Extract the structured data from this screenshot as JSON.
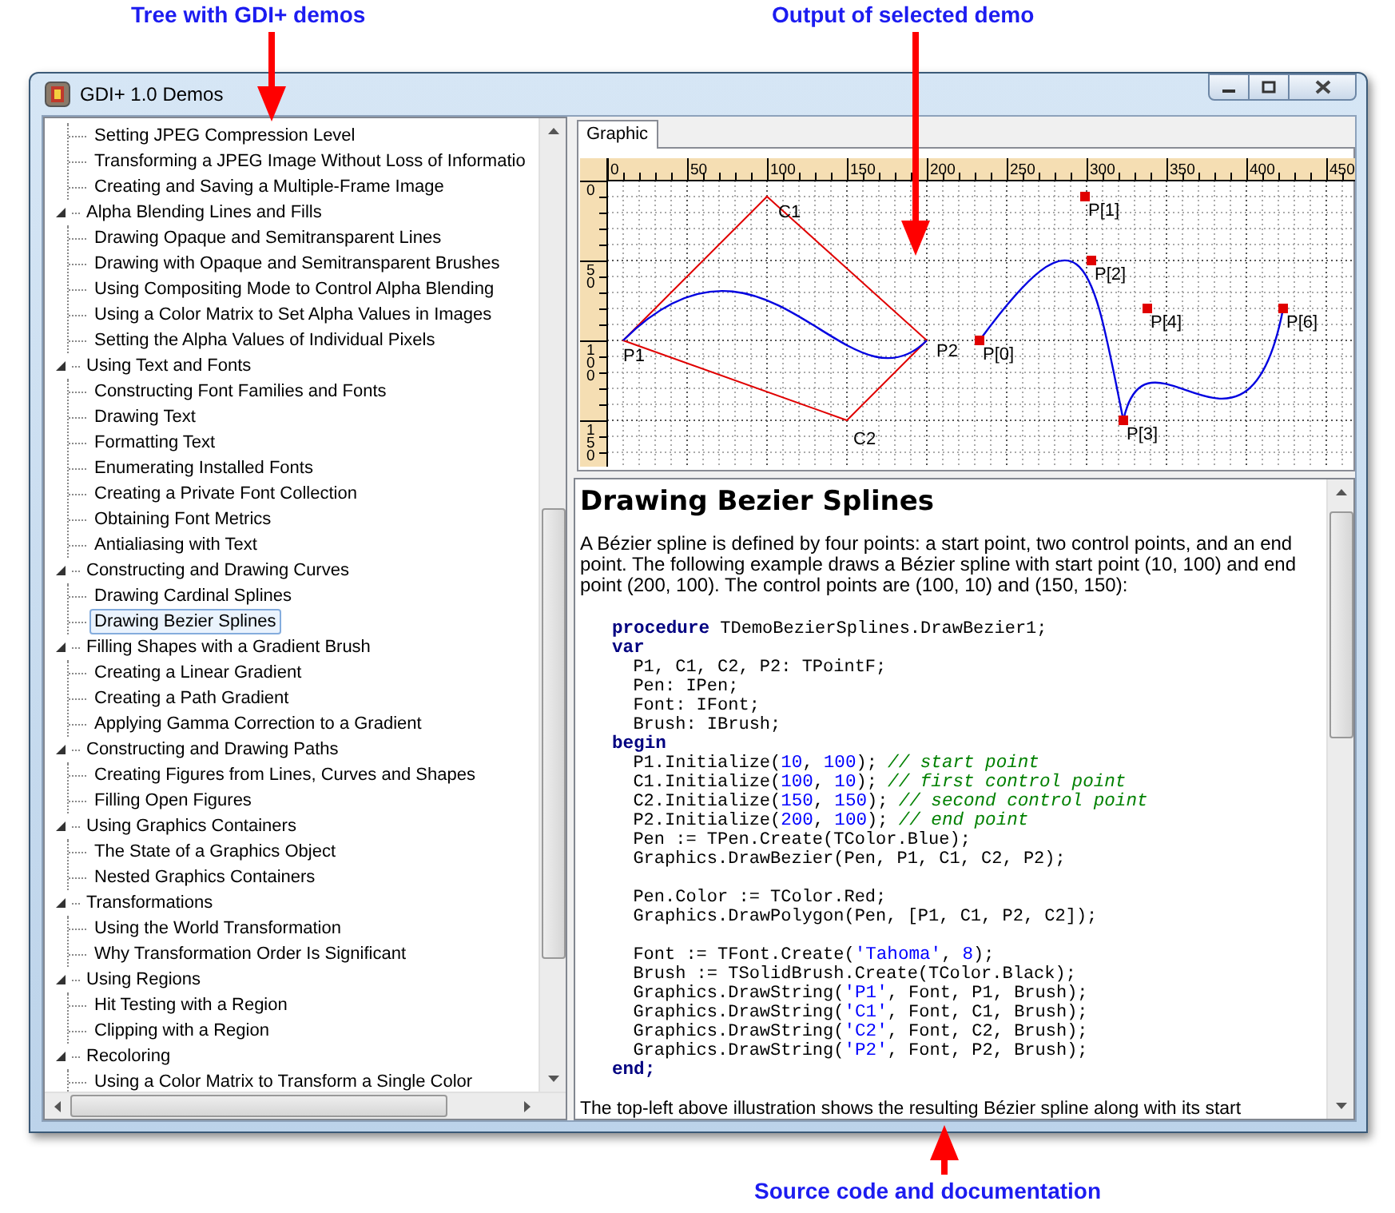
{
  "annotations": [
    {
      "text": "Tree with GDI+ demos"
    },
    {
      "text": "Output of selected demo"
    },
    {
      "text": "Source code and documentation"
    }
  ],
  "window": {
    "title": "GDI+ 1.0 Demos"
  },
  "tree": [
    {
      "children": [
        {
          "label": "Setting JPEG Compression Level",
          "selected": false
        },
        {
          "label": "Transforming a JPEG Image Without Loss of Informatio",
          "selected": false
        },
        {
          "label": "Creating and Saving a Multiple-Frame Image",
          "selected": false
        }
      ]
    },
    {
      "label": "Alpha Blending Lines and Fills",
      "expanded": true,
      "children": [
        {
          "label": "Drawing Opaque and Semitransparent Lines",
          "selected": false
        },
        {
          "label": "Drawing with Opaque and Semitransparent Brushes",
          "selected": false
        },
        {
          "label": "Using Compositing Mode to Control Alpha Blending",
          "selected": false
        },
        {
          "label": "Using a Color Matrix to Set Alpha Values in Images",
          "selected": false
        },
        {
          "label": "Setting the Alpha Values of Individual Pixels",
          "selected": false
        }
      ]
    },
    {
      "label": "Using Text and Fonts",
      "expanded": true,
      "children": [
        {
          "label": "Constructing Font Families and Fonts",
          "selected": false
        },
        {
          "label": "Drawing Text",
          "selected": false
        },
        {
          "label": "Formatting Text",
          "selected": false
        },
        {
          "label": "Enumerating Installed Fonts",
          "selected": false
        },
        {
          "label": "Creating a Private Font Collection",
          "selected": false
        },
        {
          "label": "Obtaining Font Metrics",
          "selected": false
        },
        {
          "label": "Antialiasing with Text",
          "selected": false
        }
      ]
    },
    {
      "label": "Constructing and Drawing Curves",
      "expanded": true,
      "children": [
        {
          "label": "Drawing Cardinal Splines",
          "selected": false
        },
        {
          "label": "Drawing Bezier Splines",
          "selected": true
        }
      ]
    },
    {
      "label": "Filling Shapes with a Gradient Brush",
      "expanded": true,
      "children": [
        {
          "label": "Creating a Linear Gradient",
          "selected": false
        },
        {
          "label": "Creating a Path Gradient",
          "selected": false
        },
        {
          "label": "Applying Gamma Correction to a Gradient",
          "selected": false
        }
      ]
    },
    {
      "label": "Constructing and Drawing Paths",
      "expanded": true,
      "children": [
        {
          "label": "Creating Figures from Lines, Curves and Shapes",
          "selected": false
        },
        {
          "label": "Filling Open Figures",
          "selected": false
        }
      ]
    },
    {
      "label": "Using Graphics Containers",
      "expanded": true,
      "children": [
        {
          "label": "The State of a Graphics Object",
          "selected": false
        },
        {
          "label": "Nested Graphics Containers",
          "selected": false
        }
      ]
    },
    {
      "label": "Transformations",
      "expanded": true,
      "children": [
        {
          "label": "Using the World Transformation",
          "selected": false
        },
        {
          "label": "Why Transformation Order Is Significant",
          "selected": false
        }
      ]
    },
    {
      "label": "Using Regions",
      "expanded": true,
      "children": [
        {
          "label": "Hit Testing with a Region",
          "selected": false
        },
        {
          "label": "Clipping with a Region",
          "selected": false
        }
      ]
    },
    {
      "label": "Recoloring",
      "expanded": true,
      "children": [
        {
          "label": "Using a Color Matrix to Transform a Single Color",
          "selected": false
        }
      ]
    }
  ],
  "tabs": [
    {
      "label": "Graphic",
      "selected": true
    }
  ],
  "graphic": {
    "x_ruler": [
      "0",
      "50",
      "100",
      "150",
      "200",
      "250",
      "300",
      "350",
      "400",
      "450"
    ],
    "y_ruler": [
      "0",
      "50",
      "100",
      "150"
    ],
    "bezier_labels": [
      "P1",
      "C1",
      "C2",
      "P2"
    ],
    "spline_labels": [
      "P[0]",
      "P[1]",
      "P[2]",
      "P[3]",
      "P[4]",
      "P[6]"
    ]
  },
  "doc": {
    "title": "Drawing Bezier Splines",
    "intro": "A Bézier spline is defined by four points: a start point, two control points, and an end point. The following example draws a Bézier spline with start point (10, 100) and end point (200, 100). The control points are (100, 10) and (150, 150):",
    "code_blocks": [
      [
        [
          {
            "kind": "keyword",
            "text": "procedure"
          },
          {
            "kind": "plain",
            "text": " TDemoBezierSplines.DrawBezier1;"
          }
        ],
        [
          {
            "kind": "keyword",
            "text": "var"
          }
        ],
        [
          {
            "kind": "plain",
            "text": "  P1, C1, C2, P2: TPointF;"
          }
        ],
        [
          {
            "kind": "plain",
            "text": "  Pen: IPen;"
          }
        ],
        [
          {
            "kind": "plain",
            "text": "  Font: IFont;"
          }
        ],
        [
          {
            "kind": "plain",
            "text": "  Brush: IBrush;"
          }
        ],
        [
          {
            "kind": "keyword",
            "text": "begin"
          }
        ],
        [
          {
            "kind": "plain",
            "text": "  P1.Initialize("
          },
          {
            "kind": "number",
            "text": "10"
          },
          {
            "kind": "plain",
            "text": ", "
          },
          {
            "kind": "number",
            "text": "100"
          },
          {
            "kind": "plain",
            "text": "); "
          },
          {
            "kind": "comment",
            "text": "// start point"
          }
        ],
        [
          {
            "kind": "plain",
            "text": "  C1.Initialize("
          },
          {
            "kind": "number",
            "text": "100"
          },
          {
            "kind": "plain",
            "text": ", "
          },
          {
            "kind": "number",
            "text": "10"
          },
          {
            "kind": "plain",
            "text": "); "
          },
          {
            "kind": "comment",
            "text": "// first control point"
          }
        ],
        [
          {
            "kind": "plain",
            "text": "  C2.Initialize("
          },
          {
            "kind": "number",
            "text": "150"
          },
          {
            "kind": "plain",
            "text": ", "
          },
          {
            "kind": "number",
            "text": "150"
          },
          {
            "kind": "plain",
            "text": "); "
          },
          {
            "kind": "comment",
            "text": "// second control point"
          }
        ],
        [
          {
            "kind": "plain",
            "text": "  P2.Initialize("
          },
          {
            "kind": "number",
            "text": "200"
          },
          {
            "kind": "plain",
            "text": ", "
          },
          {
            "kind": "number",
            "text": "100"
          },
          {
            "kind": "plain",
            "text": "); "
          },
          {
            "kind": "comment",
            "text": "// end point"
          }
        ],
        [
          {
            "kind": "plain",
            "text": "  Pen := TPen.Create(TColor.Blue);"
          }
        ],
        [
          {
            "kind": "plain",
            "text": "  Graphics.DrawBezier(Pen, P1, C1, C2, P2);"
          }
        ]
      ],
      [
        [
          {
            "kind": "plain",
            "text": "  Pen.Color := TColor.Red;"
          }
        ],
        [
          {
            "kind": "plain",
            "text": "  Graphics.DrawPolygon(Pen, [P1, C1, P2, C2]);"
          }
        ]
      ],
      [
        [
          {
            "kind": "plain",
            "text": "  Font := TFont.Create("
          },
          {
            "kind": "string",
            "text": "'Tahoma'"
          },
          {
            "kind": "plain",
            "text": ", "
          },
          {
            "kind": "number",
            "text": "8"
          },
          {
            "kind": "plain",
            "text": ");"
          }
        ],
        [
          {
            "kind": "plain",
            "text": "  Brush := TSolidBrush.Create(TColor.Black);"
          }
        ],
        [
          {
            "kind": "plain",
            "text": "  Graphics.DrawString("
          },
          {
            "kind": "string",
            "text": "'P1'"
          },
          {
            "kind": "plain",
            "text": ", Font, P1, Brush);"
          }
        ],
        [
          {
            "kind": "plain",
            "text": "  Graphics.DrawString("
          },
          {
            "kind": "string",
            "text": "'C1'"
          },
          {
            "kind": "plain",
            "text": ", Font, C1, Brush);"
          }
        ],
        [
          {
            "kind": "plain",
            "text": "  Graphics.DrawString("
          },
          {
            "kind": "string",
            "text": "'C2'"
          },
          {
            "kind": "plain",
            "text": ", Font, C2, Brush);"
          }
        ],
        [
          {
            "kind": "plain",
            "text": "  Graphics.DrawString("
          },
          {
            "kind": "string",
            "text": "'P2'"
          },
          {
            "kind": "plain",
            "text": ", Font, P2, Brush);"
          }
        ],
        [
          {
            "kind": "keyword",
            "text": "end;"
          }
        ]
      ]
    ],
    "outro": "The top-left above illustration shows the resulting Bézier spline along with its start"
  }
}
